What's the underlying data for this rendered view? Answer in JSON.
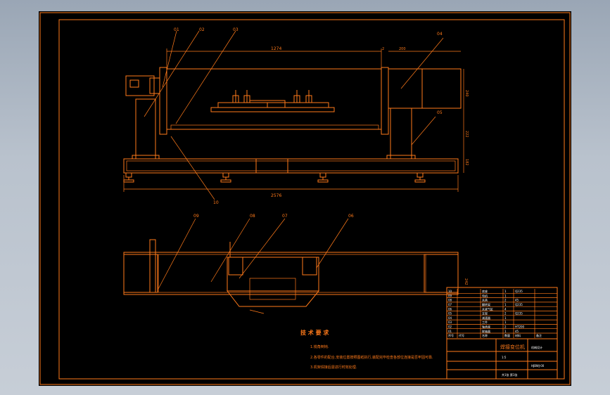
{
  "callouts": [
    "01",
    "02",
    "03",
    "04",
    "05",
    "06",
    "07",
    "08",
    "09",
    "10"
  ],
  "dims": {
    "top_width": "1274",
    "side_a": "2",
    "side_b": "200",
    "right_h1": "240",
    "right_h2": "222",
    "right_h3": "182",
    "bottom_len": "2576",
    "plan_h": "242"
  },
  "tech_req": {
    "title": "技 术 要 求",
    "line1": "1.锐角倒钝.",
    "line2": "2.各零件的配合,安装位置按照图纸执行,装配完毕检查各部位连接是否牢固可靠.",
    "line3": "3.机架焊接后需进行时效处理."
  },
  "title_block": {
    "parts": [
      {
        "no": "10",
        "name": "底座",
        "qty": "1",
        "mat": "Q235"
      },
      {
        "no": "09",
        "name": "电机",
        "qty": "1",
        "mat": ""
      },
      {
        "no": "08",
        "name": "夹具",
        "qty": "2",
        "mat": "45"
      },
      {
        "no": "07",
        "name": "翻转架",
        "qty": "1",
        "mat": "Q235"
      },
      {
        "no": "06",
        "name": "夹紧气缸",
        "qty": "4",
        "mat": ""
      },
      {
        "no": "05",
        "name": "支架",
        "qty": "2",
        "mat": "Q235"
      },
      {
        "no": "04",
        "name": "减速器",
        "qty": "1",
        "mat": ""
      },
      {
        "no": "03",
        "name": "工件",
        "qty": "1",
        "mat": ""
      },
      {
        "no": "02",
        "name": "轴承座",
        "qty": "2",
        "mat": "HT200"
      },
      {
        "no": "01",
        "name": "联轴器",
        "qty": "1",
        "mat": "45"
      }
    ],
    "header": [
      "序号",
      "代号",
      "名称",
      "数量",
      "材料",
      "备注"
    ],
    "project": "焊接变位机",
    "drawing_no": "HJBWJ-00",
    "company": "机械设计",
    "scale": "1:5",
    "sheet": "共1张 第1张"
  }
}
